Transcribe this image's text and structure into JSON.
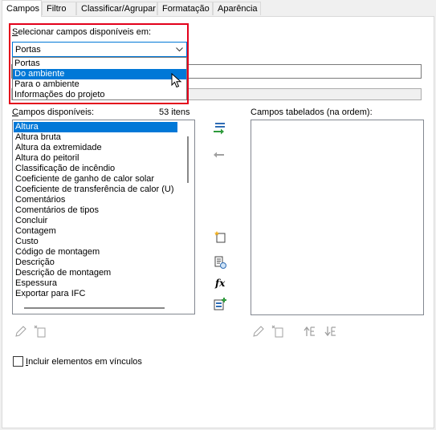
{
  "tabs": [
    "Campos",
    "Filtro",
    "Classificar/Agrupar",
    "Formatação",
    "Aparência"
  ],
  "select_from": {
    "label": "Selecionar campos disponíveis em:",
    "value": "Portas",
    "options": [
      "Portas",
      "Do ambiente",
      "Para o ambiente",
      "Informações do projeto"
    ],
    "highlighted_option": "Do ambiente"
  },
  "available": {
    "label": "Campos disponíveis:",
    "count": "53 itens",
    "items": [
      "Altura",
      "Altura bruta",
      "Altura da extremidade",
      "Altura do peitoril",
      "Classificação de incêndio",
      "Coeficiente de ganho de calor solar",
      "Coeficiente de transferência de calor (U)",
      "Comentários",
      "Comentários de tipos",
      "Concluir",
      "Contagem",
      "Custo",
      "Código de montagem",
      "Descrição",
      "Descrição de montagem",
      "Espessura",
      "Exportar para IFC"
    ],
    "selected_item": "Altura"
  },
  "scheduled": {
    "label": "Campos tabelados (na ordem):"
  },
  "include_links": {
    "label": "Incluir elementos em vínculos",
    "checked": false
  },
  "icons": {
    "add": "add-field-icon",
    "remove": "remove-field-icon",
    "new_param": "new-parameter-icon",
    "edit_param": "edit-parameter-icon",
    "calc": "calculated-value-icon",
    "combine": "combine-parameters-icon",
    "edit": "edit-icon",
    "delete": "delete-icon",
    "move_up": "move-up-icon",
    "move_down": "move-down-icon"
  },
  "colors": {
    "highlight_border": "#e3001b",
    "selection": "#0078d7"
  }
}
